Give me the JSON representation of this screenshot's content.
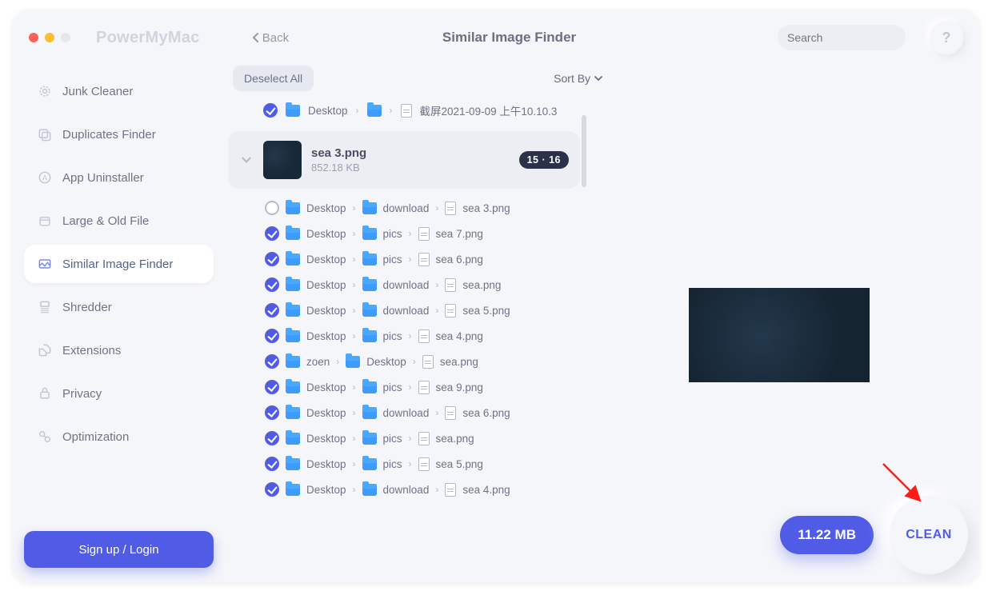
{
  "brand": "PowerMyMac",
  "back_label": "Back",
  "page_title": "Similar Image Finder",
  "search": {
    "placeholder": "Search"
  },
  "help_label": "?",
  "sidebar": {
    "items": [
      {
        "label": "Junk Cleaner"
      },
      {
        "label": "Duplicates Finder"
      },
      {
        "label": "App Uninstaller"
      },
      {
        "label": "Large & Old File"
      },
      {
        "label": "Similar Image Finder"
      },
      {
        "label": "Shredder"
      },
      {
        "label": "Extensions"
      },
      {
        "label": "Privacy"
      },
      {
        "label": "Optimization"
      }
    ],
    "active_index": 4,
    "signup_label": "Sign up / Login"
  },
  "toolbar": {
    "deselect_label": "Deselect All",
    "sort_label": "Sort By"
  },
  "partial_row": {
    "checked": true,
    "path": [
      "Desktop",
      ""
    ],
    "tail": "截屏2021-09-09 上午10.10.3"
  },
  "group": {
    "name": "sea 3.png",
    "size": "852.18 KB",
    "badge": "15 · 16"
  },
  "files": [
    {
      "checked": false,
      "crumbs": [
        "Desktop",
        "download"
      ],
      "file": "sea 3.png"
    },
    {
      "checked": true,
      "crumbs": [
        "Desktop",
        "pics"
      ],
      "file": "sea 7.png"
    },
    {
      "checked": true,
      "crumbs": [
        "Desktop",
        "pics"
      ],
      "file": "sea 6.png"
    },
    {
      "checked": true,
      "crumbs": [
        "Desktop",
        "download"
      ],
      "file": "sea.png"
    },
    {
      "checked": true,
      "crumbs": [
        "Desktop",
        "download"
      ],
      "file": "sea 5.png"
    },
    {
      "checked": true,
      "crumbs": [
        "Desktop",
        "pics"
      ],
      "file": "sea 4.png"
    },
    {
      "checked": true,
      "crumbs": [
        "zoen",
        "Desktop"
      ],
      "file": "sea.png"
    },
    {
      "checked": true,
      "crumbs": [
        "Desktop",
        "pics"
      ],
      "file": "sea 9.png"
    },
    {
      "checked": true,
      "crumbs": [
        "Desktop",
        "download"
      ],
      "file": "sea 6.png"
    },
    {
      "checked": true,
      "crumbs": [
        "Desktop",
        "pics"
      ],
      "file": "sea.png"
    },
    {
      "checked": true,
      "crumbs": [
        "Desktop",
        "pics"
      ],
      "file": "sea 5.png"
    },
    {
      "checked": true,
      "crumbs": [
        "Desktop",
        "download"
      ],
      "file": "sea 4.png"
    }
  ],
  "footer": {
    "size_label": "11.22 MB",
    "clean_label": "CLEAN"
  }
}
